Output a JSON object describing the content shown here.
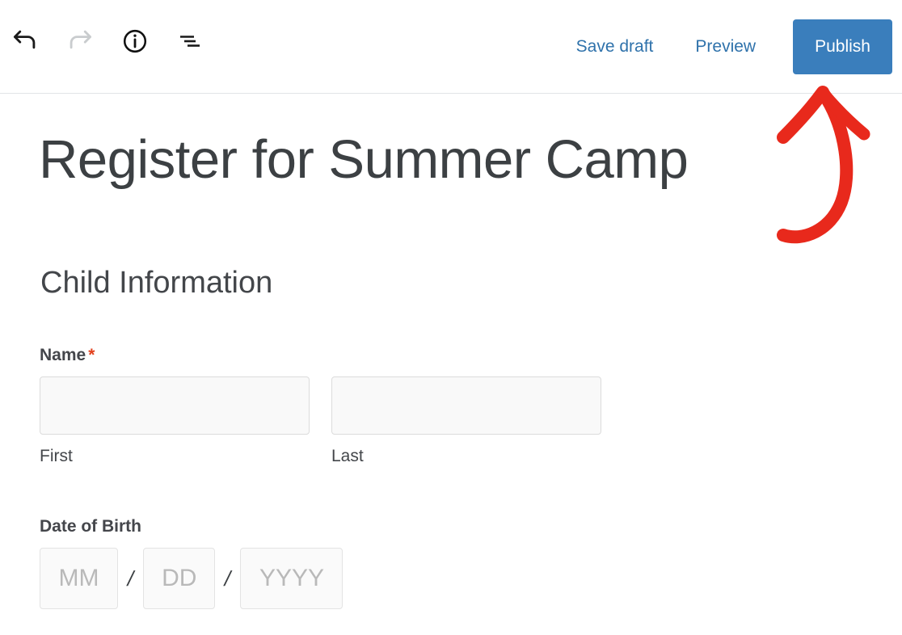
{
  "toolbar": {
    "icons": [
      {
        "name": "undo-icon",
        "label": "Undo",
        "state": "enabled"
      },
      {
        "name": "redo-icon",
        "label": "Redo",
        "state": "disabled"
      },
      {
        "name": "info-icon",
        "label": "Details",
        "state": "enabled"
      },
      {
        "name": "outline-icon",
        "label": "Document outline",
        "state": "enabled"
      }
    ],
    "save_draft_label": "Save draft",
    "preview_label": "Preview",
    "publish_label": "Publish",
    "link_color": "#2f72ab",
    "publish_bg": "#3a7ebc",
    "publish_text_color": "#ffffff"
  },
  "form": {
    "title": "Register for Summer Camp",
    "section_heading": "Child Information",
    "name_field": {
      "label": "Name",
      "required_marker": "*",
      "required_color": "#e2401c",
      "first": {
        "value": "",
        "placeholder": "",
        "sub_label": "First"
      },
      "last": {
        "value": "",
        "placeholder": "",
        "sub_label": "Last"
      }
    },
    "date_of_birth_field": {
      "label": "Date of Birth",
      "separator": "/",
      "month": {
        "value": "",
        "placeholder": "MM"
      },
      "day": {
        "value": "",
        "placeholder": "DD"
      },
      "year": {
        "value": "",
        "placeholder": "YYYY"
      }
    }
  },
  "annotation": {
    "name": "red-arrow-pointing-to-publish",
    "color": "#e8291c",
    "points_to": "Publish"
  }
}
